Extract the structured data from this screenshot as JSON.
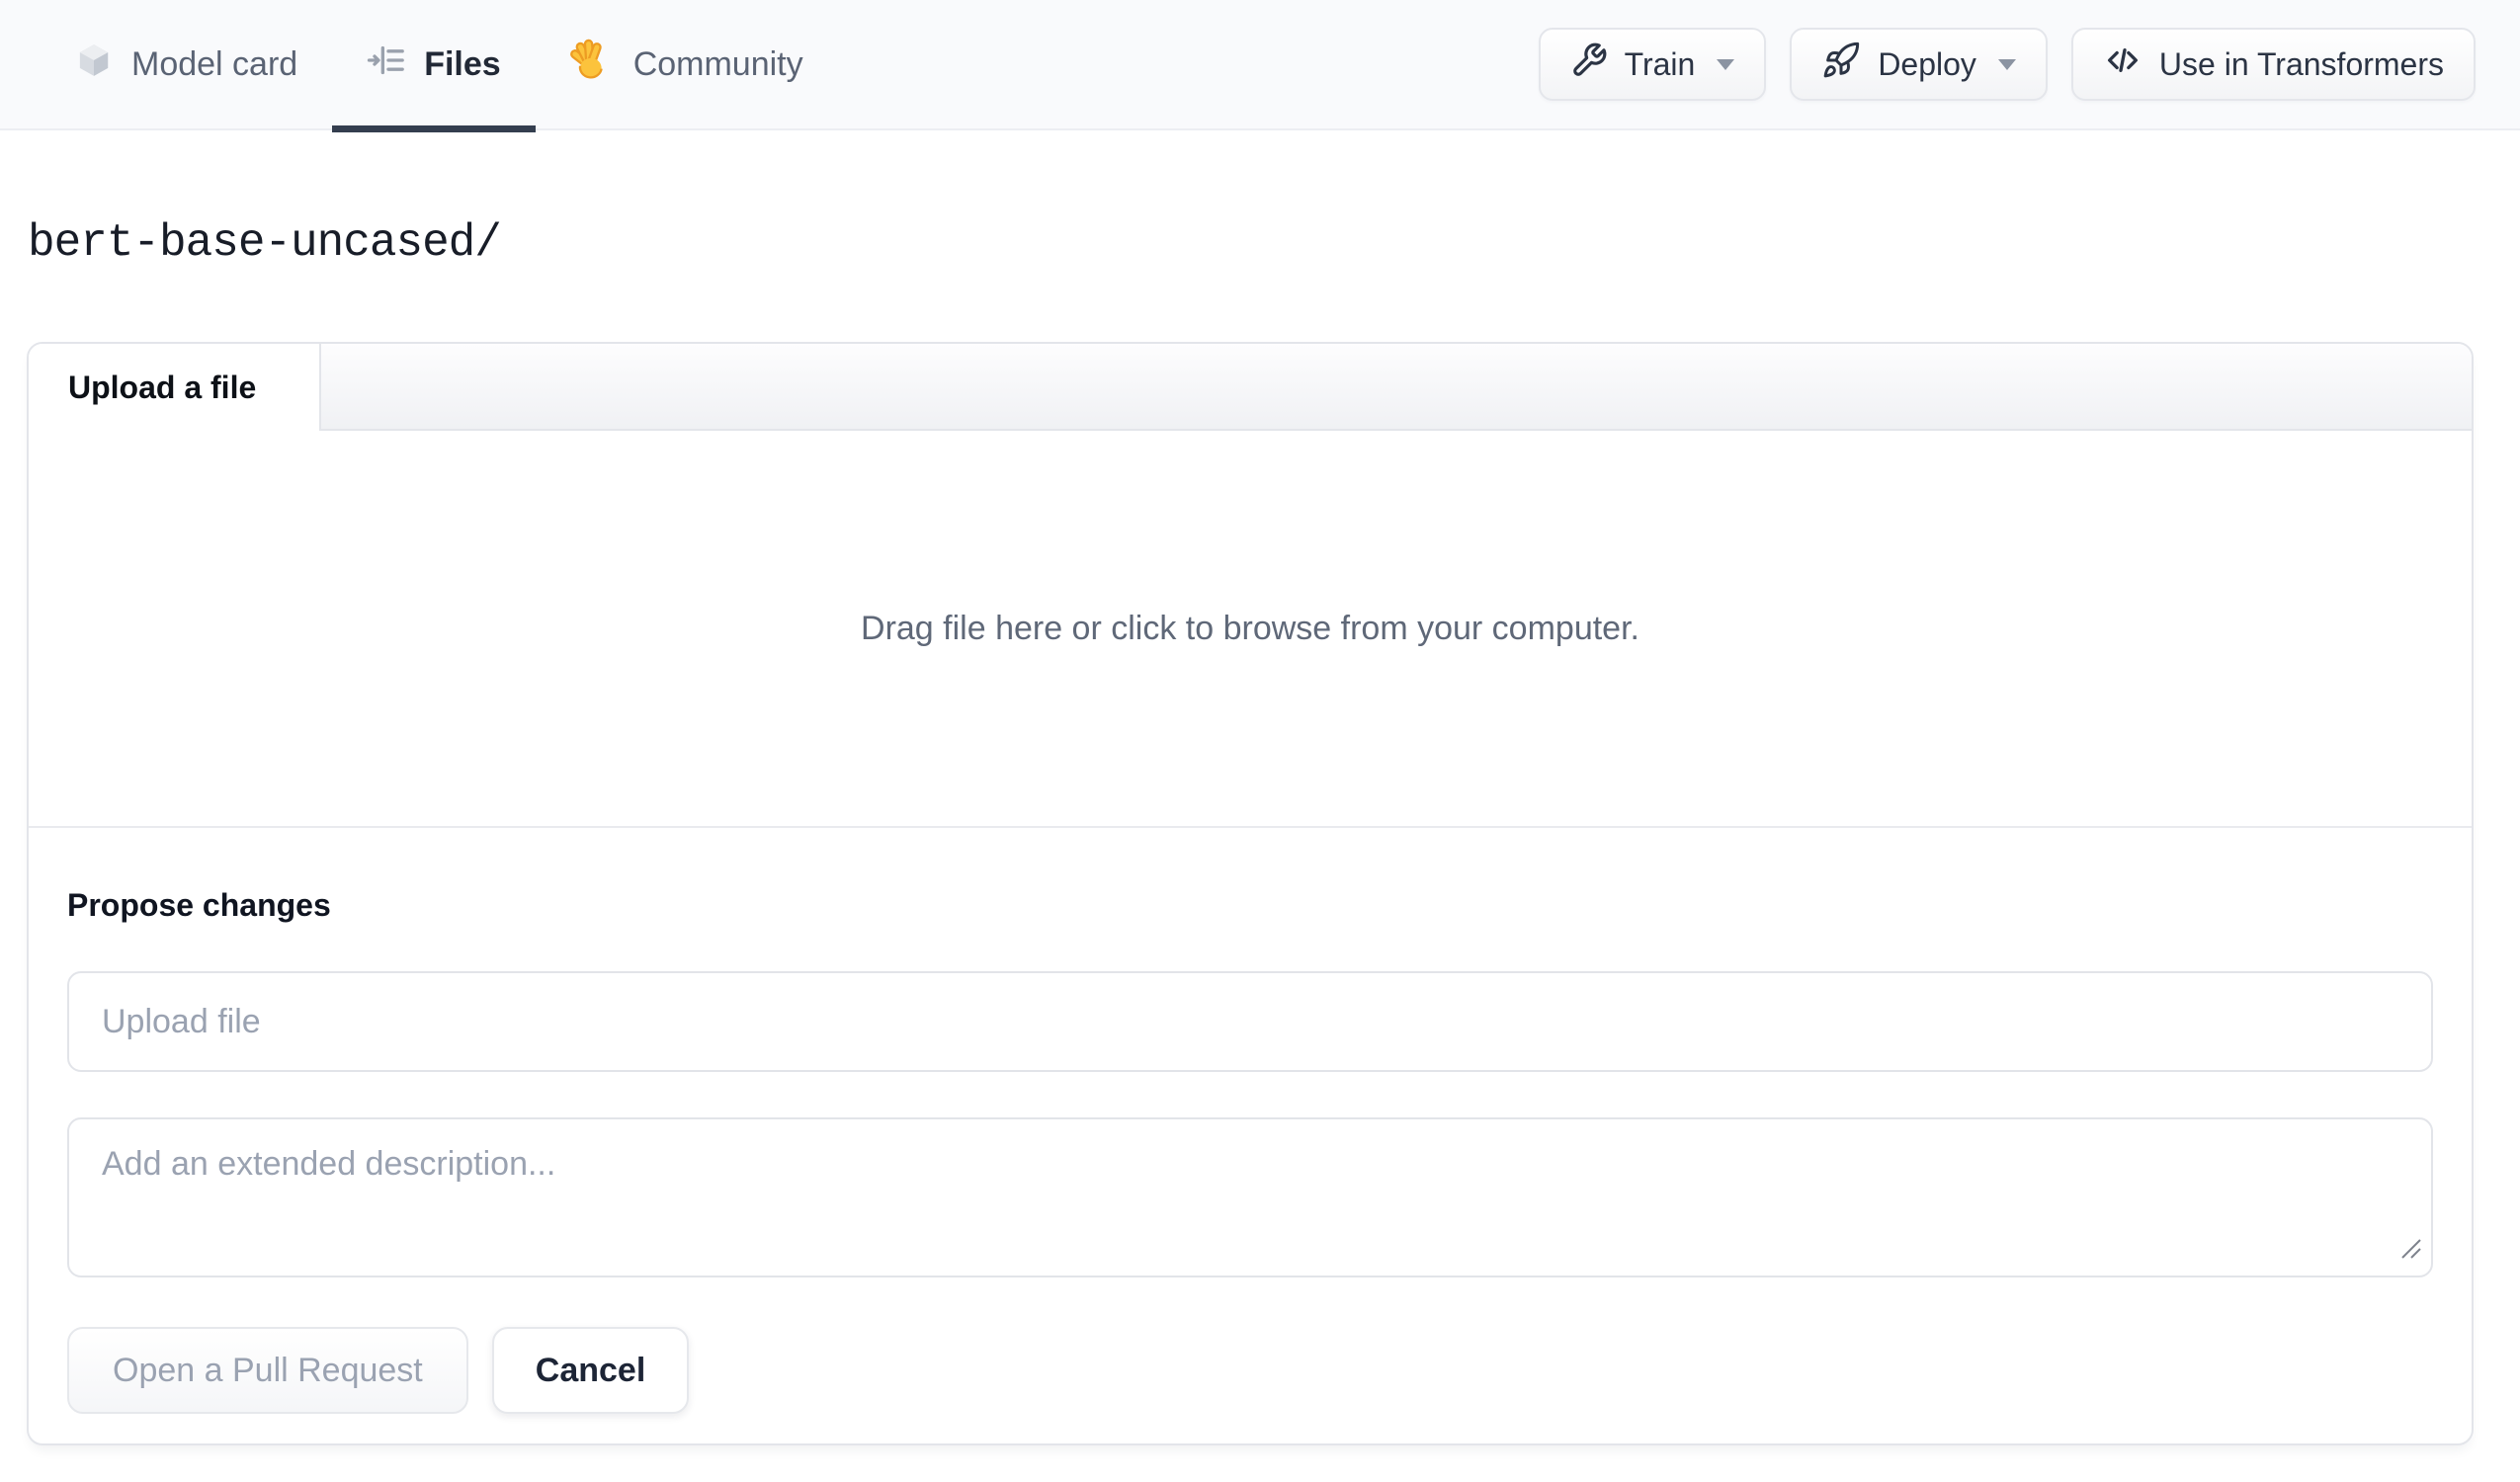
{
  "colors": {
    "accent_underline": "#343e4f",
    "navbar_bg": "#f9fafc",
    "muted_text": "#9aa2b1",
    "hand_yellow": "#fcc33c",
    "hand_orange": "#ed9c23"
  },
  "nav": {
    "tabs": [
      {
        "label": "Model card",
        "icon": "cube-icon",
        "active": false
      },
      {
        "label": "Files",
        "icon": "files-list-icon",
        "active": true
      },
      {
        "label": "Community",
        "icon": "waving-hand-icon",
        "active": false
      }
    ],
    "actions": [
      {
        "label": "Train",
        "icon": "wrench-icon",
        "has_caret": true
      },
      {
        "label": "Deploy",
        "icon": "rocket-icon",
        "has_caret": true
      },
      {
        "label": "Use in Transformers",
        "icon": "code-icon",
        "has_caret": false
      }
    ]
  },
  "breadcrumb": {
    "path": "bert-base-uncased/"
  },
  "upload_card": {
    "tab_label": "Upload a file",
    "dropzone_text": "Drag file here or click to browse from your computer.",
    "propose_heading": "Propose changes",
    "file_input": {
      "value": "",
      "placeholder": "Upload file"
    },
    "description_input": {
      "value": "",
      "placeholder": "Add an extended description..."
    },
    "buttons": {
      "open_pr_label": "Open a Pull Request",
      "cancel_label": "Cancel"
    }
  }
}
